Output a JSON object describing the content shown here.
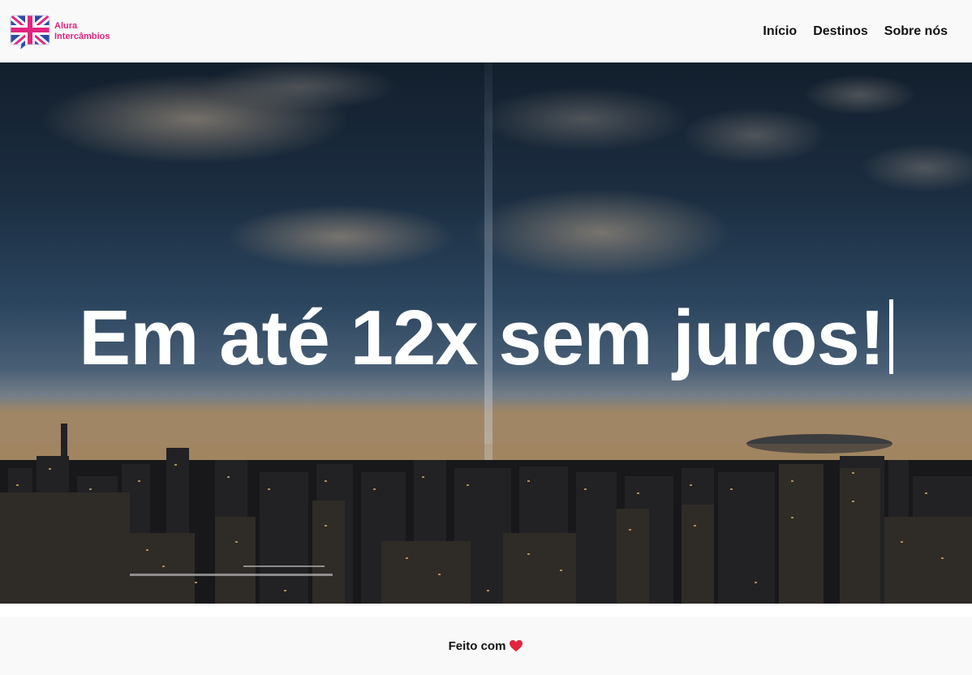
{
  "header": {
    "logo": {
      "line1": "Alura",
      "line2": "Intercâmbios",
      "icon": "uk-flag-speech-bubble-icon"
    },
    "nav": [
      {
        "label": "Início"
      },
      {
        "label": "Destinos"
      },
      {
        "label": "Sobre nós"
      }
    ]
  },
  "hero": {
    "title": "Em até 12x sem juros!",
    "background": "night-city-skyline-image"
  },
  "footer": {
    "text": "Feito com",
    "icon": "heart-icon"
  },
  "colors": {
    "brand_pink": "#e0267f",
    "heart_red": "#e0263c",
    "text_dark": "#111111",
    "background": "#f9f9f9"
  }
}
